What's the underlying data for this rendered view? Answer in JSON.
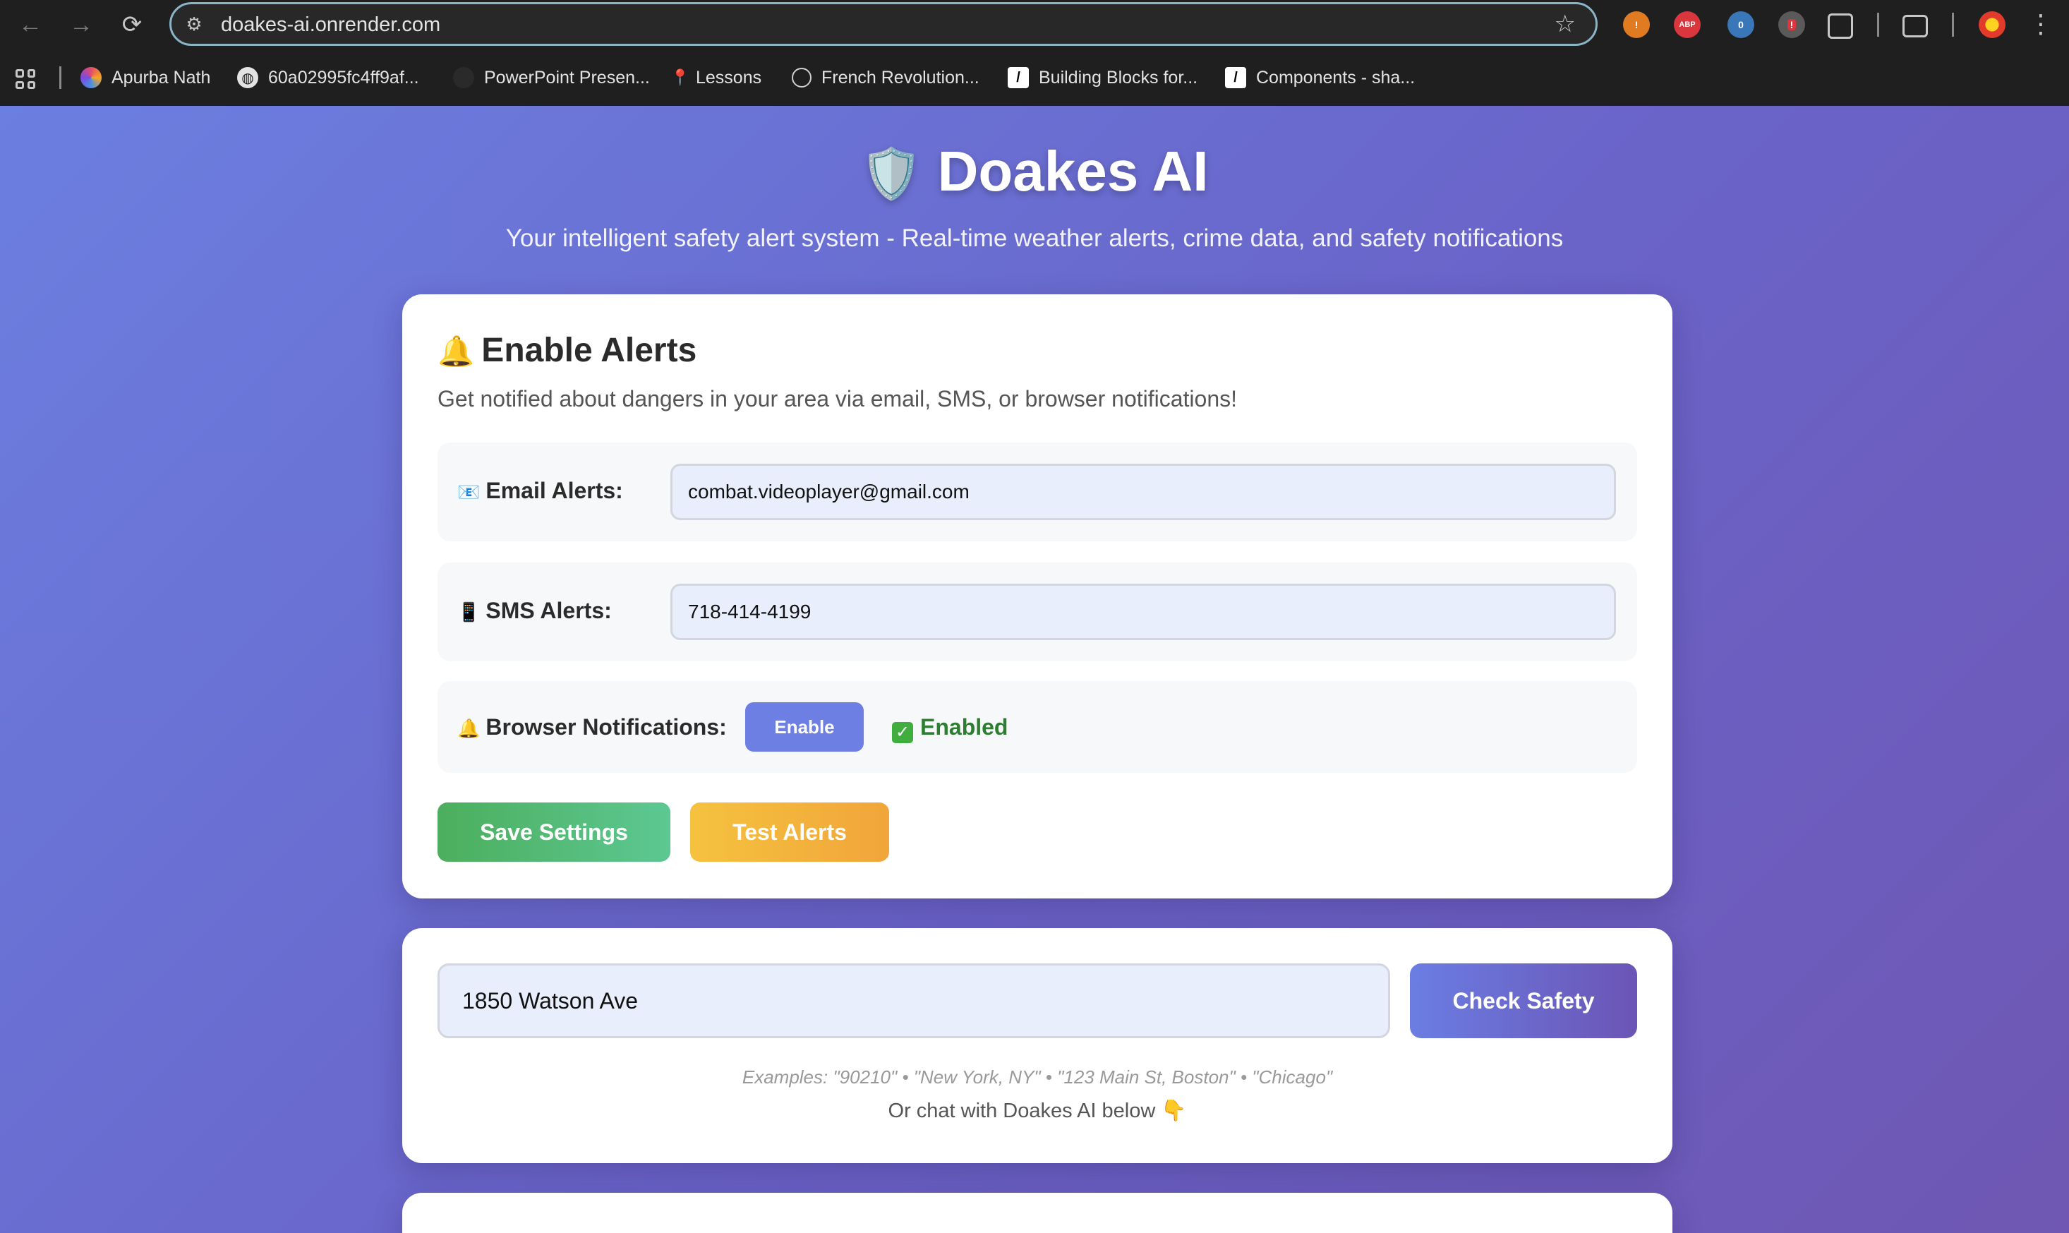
{
  "browser": {
    "url": "doakes-ai.onrender.com",
    "nav": {
      "back": "←",
      "forward": "→",
      "reload": "⟳"
    },
    "extensions": [
      {
        "name": "brave-shield-icon",
        "label": "!"
      },
      {
        "name": "adblock-plus-icon",
        "label": "ABP"
      },
      {
        "name": "privacy-badger-icon",
        "label": "0"
      },
      {
        "name": "security-extension-icon",
        "label": "!"
      },
      {
        "name": "extensions-puzzle-icon",
        "label": ""
      },
      {
        "name": "reading-list-icon",
        "label": ""
      },
      {
        "name": "profile-avatar-icon",
        "label": ""
      }
    ],
    "bookmarks": [
      {
        "label": "Apurba Nath",
        "icon": "colorful-swirl-icon",
        "color": "#e24b6b"
      },
      {
        "label": "60a02995fc4ff9af...",
        "icon": "globe-icon",
        "color": "#555555"
      },
      {
        "label": "PowerPoint Presen...",
        "icon": "blank-page-icon",
        "color": "#2a2a2a"
      },
      {
        "label": "Lessons",
        "icon": "pin-icon",
        "color": "#6b6b6b"
      },
      {
        "label": "French Revolution...",
        "icon": "openai-icon",
        "color": "#3a3a3a"
      },
      {
        "label": "Building Blocks for...",
        "icon": "shadcn-icon",
        "color": "#000000"
      },
      {
        "label": "Components - sha...",
        "icon": "shadcn-icon",
        "color": "#000000"
      }
    ]
  },
  "header": {
    "shield": "🛡️",
    "title": "Doakes AI",
    "tagline": "Your intelligent safety alert system - Real-time weather alerts, crime data, and safety notifications"
  },
  "alerts": {
    "bell": "🔔",
    "title": "Enable Alerts",
    "description": "Get notified about dangers in your area via email, SMS, or browser notifications!",
    "email": {
      "icon": "📧",
      "label": "Email Alerts:",
      "value": "combat.videoplayer@gmail.com"
    },
    "sms": {
      "icon": "📱",
      "label": "SMS Alerts:",
      "value": "718-414-4199"
    },
    "browser": {
      "icon": "🔔",
      "label": "Browser Notifications:",
      "button": "Enable",
      "status_check": "✓",
      "status": "Enabled"
    },
    "save_label": "Save Settings",
    "test_label": "Test Alerts"
  },
  "search": {
    "value": "1850 Watson Ave",
    "button": "Check Safety",
    "examples": "Examples: \"90210\" • \"New York, NY\" • \"123 Main St, Boston\" • \"Chicago\"",
    "chat_hint": "Or chat with Doakes AI below 👇"
  },
  "colors": {
    "accent": "#6e7fe3",
    "success": "#2e7d32",
    "save_gradient": "#4cae5d",
    "test_gradient": "#f5c23f"
  }
}
